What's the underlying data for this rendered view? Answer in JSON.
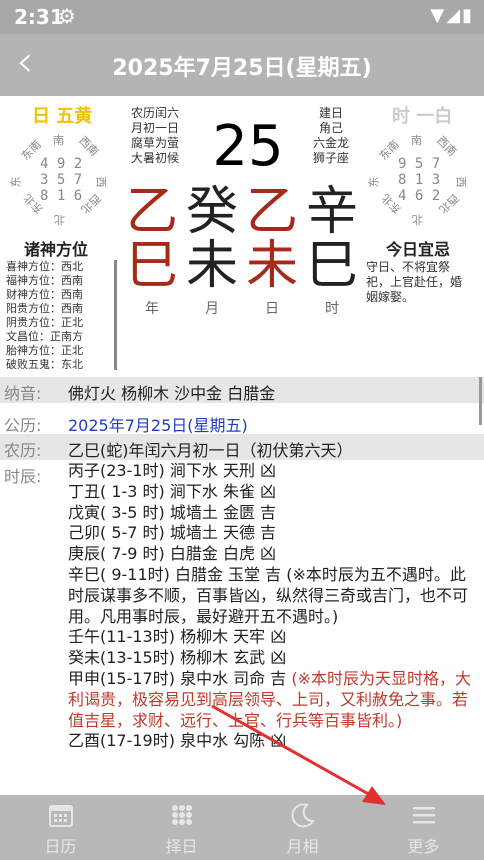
{
  "status": {
    "time": "2:31"
  },
  "header": {
    "title": "2025年7月25日(星期五)"
  },
  "panel": {
    "left_star": "日 五黄",
    "left_grid": [
      "4 9 2",
      "3 5 7",
      "8 1 6"
    ],
    "left_dirs": {
      "n": "南",
      "ne": "西南",
      "e": "西",
      "se": "西北",
      "s": "北",
      "sw": "东北",
      "w": "东",
      "nw": "东南"
    },
    "right_star": "时 一白",
    "right_grid": [
      "9 5 7",
      "8 1 3",
      "4 6 2"
    ],
    "right_dirs": {
      "n": "南",
      "ne": "西南",
      "e": "西",
      "se": "西北",
      "s": "北",
      "sw": "东北",
      "w": "东",
      "nw": "东南"
    },
    "lunar_lines": [
      "农历闰六",
      "月初一日",
      "腐草为萤",
      "大暑初候"
    ],
    "right_lines": [
      "建日",
      "角己",
      "六金龙",
      "狮子座"
    ],
    "day_number": "25",
    "ganzhi_top": [
      "乙",
      "癸",
      "乙",
      "辛"
    ],
    "ganzhi_bottom": [
      "巳",
      "未",
      "未",
      "巳"
    ],
    "ganzhi_labels": [
      "年",
      "月",
      "日",
      "时"
    ],
    "left_heading": "诸神方位",
    "directions": [
      "喜神方位：西北",
      "福神方位：西南",
      "财神方位：西南",
      "阳贵方位：西南",
      "阴贵方位：正北",
      "文昌位：正南方",
      "胎神方位：正北",
      "破败五鬼：东北"
    ],
    "right_heading": "今日宜忌",
    "yiji_text": "守日、不将宜祭祀，上官赴任，婚姻嫁娶。"
  },
  "rows": {
    "nayin_label": "纳音:",
    "nayin_value": "佛灯火    杨柳木    沙中金    白腊金",
    "gongli_label": "公历:",
    "gongli_value": "2025年7月25日(星期五)",
    "nongli_label": "农历:",
    "nongli_value": "乙巳(蛇)年闰六月初一日（初伏第六天）",
    "shichen_label": "时辰:"
  },
  "shichen": [
    {
      "text": "丙子(23-1时) 涧下水 天刑 凶",
      "note": ""
    },
    {
      "text": "丁丑( 1-3 时) 涧下水 朱雀 凶",
      "note": ""
    },
    {
      "text": "戊寅( 3-5 时) 城墙土 金匮 吉",
      "note": ""
    },
    {
      "text": "己卯( 5-7 时) 城墙土 天德 吉",
      "note": ""
    },
    {
      "text": "庚辰( 7-9 时) 白腊金 白虎 凶",
      "note": ""
    },
    {
      "text": "辛巳( 9-11时) 白腊金 玉堂 吉 (※本时辰为五不遇时。此时辰谋事多不顺，百事皆凶，纵然得三奇或吉门，也不可用。凡用事时辰，最好避开五不遇时。)",
      "note": ""
    },
    {
      "text": "壬午(11-13时) 杨柳木 天牢 凶",
      "note": ""
    },
    {
      "text": "癸未(13-15时) 杨柳木 玄武 凶",
      "note": ""
    },
    {
      "text": "甲申(15-17时) 泉中水 司命 吉 ",
      "note": "(※本时辰为天显时格，大利谒贵，极容易见到高层领导、上司，又利赦免之事。若值吉星，求财、远行、上官、行兵等百事皆利。)"
    },
    {
      "text": "乙酉(17-19时) 泉中水 勾陈 凶",
      "note": ""
    }
  ],
  "nav": [
    {
      "label": "日历",
      "icon": "calendar-icon"
    },
    {
      "label": "择日",
      "icon": "grid-icon"
    },
    {
      "label": "月相",
      "icon": "moon-icon"
    },
    {
      "label": "更多",
      "icon": "menu-icon"
    }
  ],
  "colors": {
    "status_bg": "#a8a8a8",
    "header_bg": "#b4b4b4",
    "ganzhi_red": "#a52a1a",
    "star_yellow": "#f2c200",
    "gongli_blue": "#1f3fbf",
    "note_red": "#c0392b",
    "arrow_red": "#e03030"
  }
}
